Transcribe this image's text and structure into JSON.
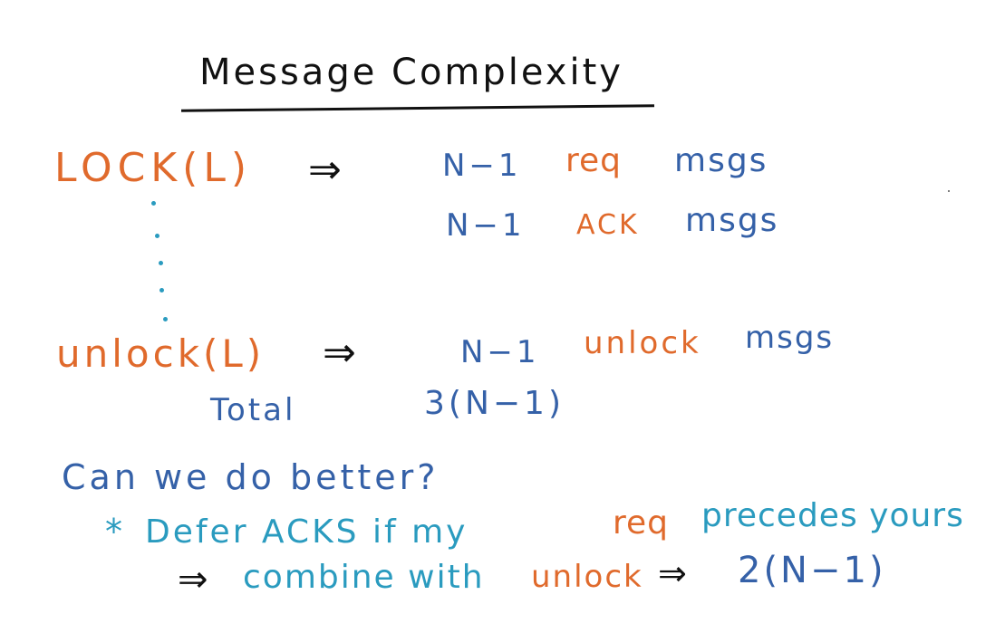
{
  "title": "Message Complexity",
  "lock": {
    "label": "LOCK(L)",
    "arrow": "⇒",
    "req_count": "N−1",
    "req_word": "req",
    "req_msgs": "msgs",
    "ack_count": "N−1",
    "ack_word": "ACK",
    "ack_msgs": "msgs"
  },
  "unlock": {
    "label": "unlock(L)",
    "arrow": "⇒",
    "count": "N−1",
    "word": "unlock",
    "msgs": "msgs"
  },
  "total": {
    "label": "Total",
    "value": "3(N−1)"
  },
  "question": "Can we do better?",
  "improvement": {
    "star": "*",
    "defer_text": "Defer ACKS if my",
    "req_word": "req",
    "precedes_text": "precedes yours",
    "arrow": "⇒",
    "combine_text": "combine with",
    "unlock_word": "unlock",
    "result_arrow": "⇒",
    "result": "2(N−1)"
  },
  "colors": {
    "black": "#111111",
    "orange": "#e06a2c",
    "blue": "#3561a8",
    "teal": "#2a9bbf"
  }
}
